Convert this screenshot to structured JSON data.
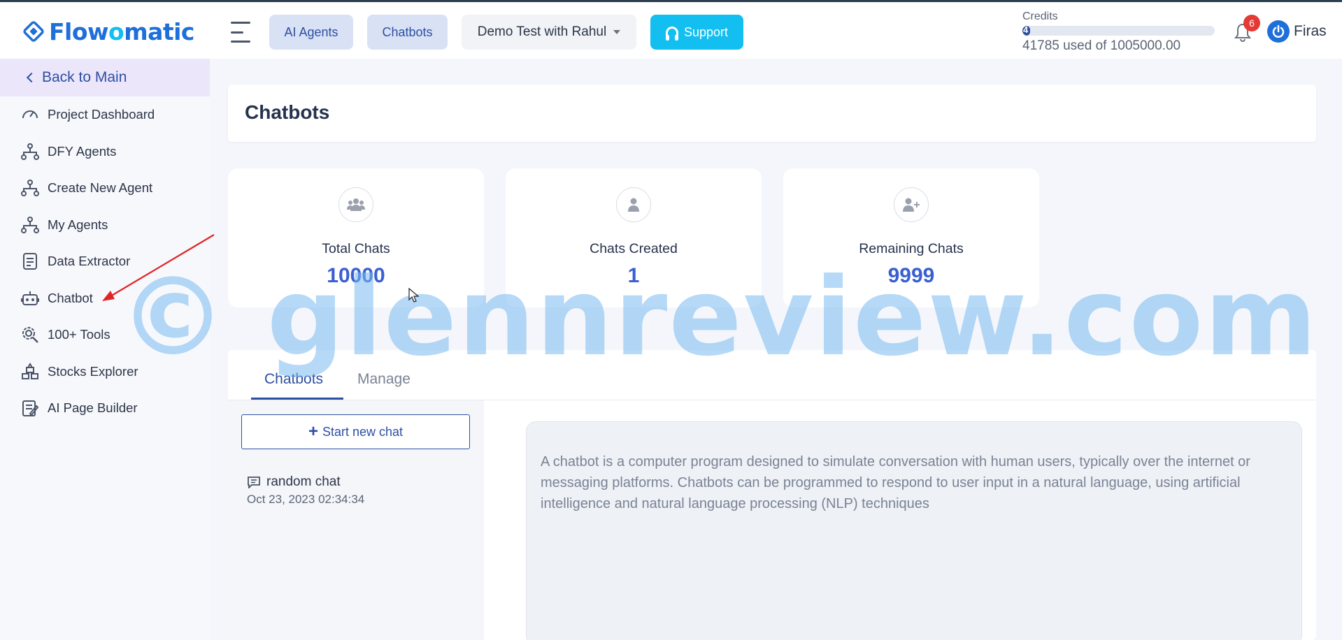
{
  "app": {
    "logo_text_before": "Flow",
    "logo_text_o": "o",
    "logo_text_after": "matic"
  },
  "header": {
    "ai_agents_label": "AI Agents",
    "chatbots_label": "Chatbots",
    "project_select_value": "Demo Test with Rahul",
    "support_label": "Support",
    "credits_label": "Credits",
    "credits_bar_text": "4",
    "credits_used_text": "41785 used of 1005000.00",
    "credits_used_fraction": 0.0416,
    "notification_count": "6",
    "user_name": "Firas"
  },
  "sidebar": {
    "back_label": "Back to Main",
    "items": [
      {
        "label": "Project Dashboard",
        "icon": "gauge-icon"
      },
      {
        "label": "DFY Agents",
        "icon": "hierarchy-icon"
      },
      {
        "label": "Create New Agent",
        "icon": "hierarchy-icon"
      },
      {
        "label": "My Agents",
        "icon": "hierarchy-icon"
      },
      {
        "label": "Data Extractor",
        "icon": "document-icon"
      },
      {
        "label": "Chatbot",
        "icon": "robot-icon"
      },
      {
        "label": "100+ Tools",
        "icon": "gear-search-icon"
      },
      {
        "label": "Stocks Explorer",
        "icon": "blocks-icon"
      },
      {
        "label": "AI Page Builder",
        "icon": "page-builder-icon"
      }
    ]
  },
  "main": {
    "page_title": "Chatbots",
    "stats": [
      {
        "label": "Total Chats",
        "value": "10000",
        "icon": "users-icon"
      },
      {
        "label": "Chats Created",
        "value": "1",
        "icon": "user-icon"
      },
      {
        "label": "Remaining Chats",
        "value": "9999",
        "icon": "user-plus-icon"
      }
    ],
    "tabs": [
      {
        "label": "Chatbots",
        "active": true
      },
      {
        "label": "Manage",
        "active": false
      }
    ],
    "start_new_chat_label": "Start new chat",
    "chats": [
      {
        "title": "random chat",
        "date": "Oct 23, 2023 02:34:34"
      }
    ],
    "description": "A chatbot is a computer program designed to simulate conversation with human users, typically over the internet or messaging platforms. Chatbots can be programmed to respond to user input in a natural language, using artificial intelligence and natural language processing (NLP) techniques"
  },
  "watermark": {
    "text": "© glennreview.com"
  },
  "colors": {
    "brand": "#1e6fd9",
    "accent": "#2d4fa3",
    "support": "#12bff0",
    "badge": "#e53935",
    "stat_value": "#3a5fd0"
  }
}
